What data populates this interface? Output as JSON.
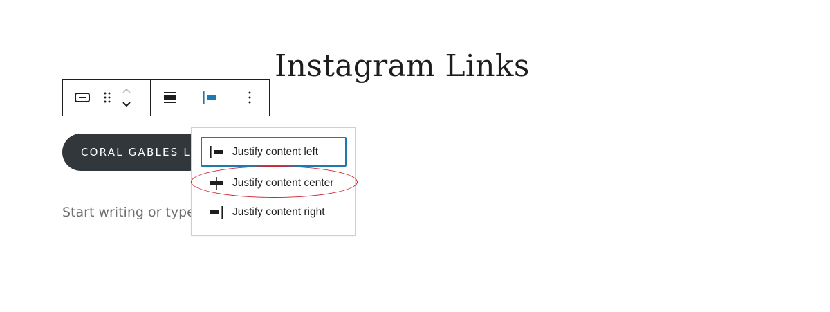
{
  "page": {
    "title": "Instagram Links",
    "placeholder": "Start writing or type"
  },
  "block_button": {
    "label": "CORAL GABLES LO"
  },
  "toolbar": {
    "icons": [
      "button-block-icon",
      "drag-handle-icon",
      "move-up-icon",
      "move-down-icon",
      "align-icon",
      "justify-left-icon",
      "more-options-icon"
    ],
    "accent_color": "#1f79b1"
  },
  "justify_menu": {
    "items": [
      {
        "label": "Justify content left",
        "icon": "justify-left-icon",
        "selected": true
      },
      {
        "label": "Justify content center",
        "icon": "justify-center-icon",
        "selected": false
      },
      {
        "label": "Justify content right",
        "icon": "justify-right-icon",
        "selected": false
      }
    ],
    "highlight_color": "#d0202f"
  }
}
